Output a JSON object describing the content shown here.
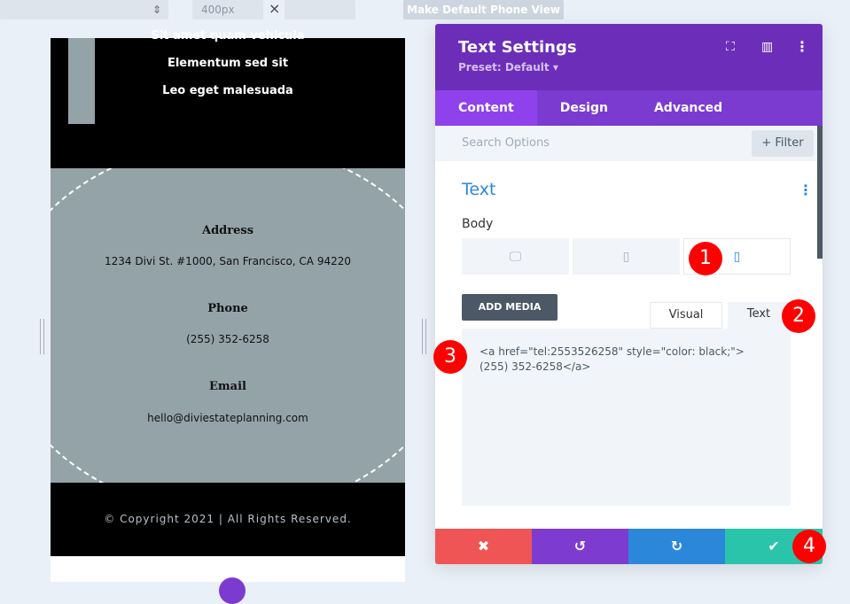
{
  "toolbar": {
    "width_value": "400px",
    "clear_icon": "×",
    "make_default_label": "Make Default Phone View"
  },
  "preview": {
    "menu_items": [
      "Sit amet quam vehicula",
      "Elementum sed sit",
      "Leo eget malesuada"
    ],
    "contact": [
      {
        "label": "Address",
        "value": "1234 Divi St. #1000, San Francisco, CA 94220"
      },
      {
        "label": "Phone",
        "value": "(255) 352-6258"
      },
      {
        "label": "Email",
        "value": "hello@diviestateplanning.com"
      }
    ],
    "copyright": "© Copyright 2021 | All Rights Reserved."
  },
  "panel": {
    "title": "Text Settings",
    "preset": "Preset: Default ▾",
    "tabs": [
      "Content",
      "Design",
      "Advanced"
    ],
    "search_placeholder": "Search Options",
    "filter_label": "+ Filter",
    "section_title": "Text",
    "body_label": "Body",
    "add_media": "ADD MEDIA",
    "editor_tabs": [
      "Visual",
      "Text"
    ],
    "code": "<a href=\"tel:2553526258\" style=\"color: black;\">(255) 352-6258</a>"
  },
  "badges": [
    "1",
    "2",
    "3",
    "4"
  ],
  "colors": {
    "header": "#6c2eb9",
    "tabs": "#7b3bd0",
    "cancel": "#ef5555",
    "undo": "#7e3bd0",
    "redo": "#2b87da",
    "save": "#29c4a9",
    "badge": "#ff0000"
  }
}
